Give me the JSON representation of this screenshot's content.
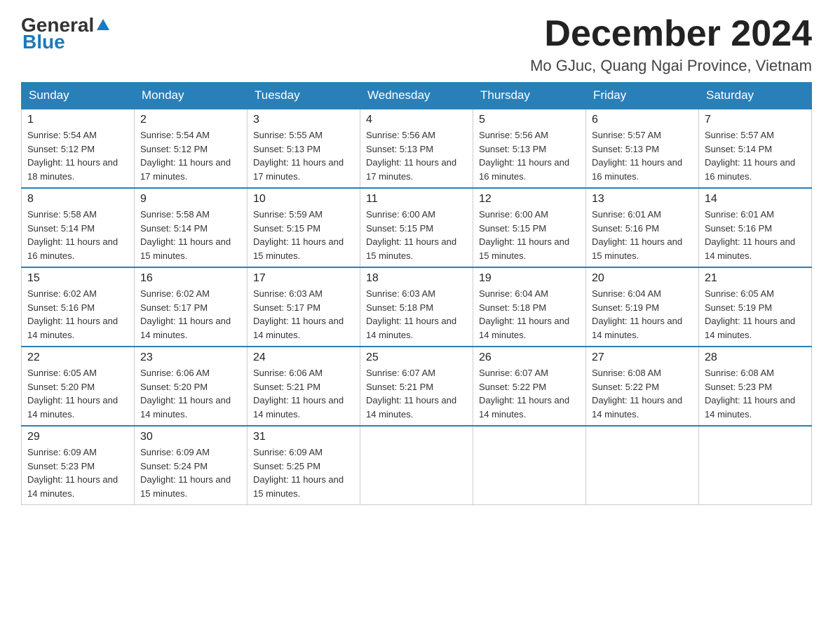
{
  "header": {
    "logo_general": "General",
    "logo_blue": "Blue",
    "month_title": "December 2024",
    "location": "Mo GJuc, Quang Ngai Province, Vietnam"
  },
  "weekdays": [
    "Sunday",
    "Monday",
    "Tuesday",
    "Wednesday",
    "Thursday",
    "Friday",
    "Saturday"
  ],
  "weeks": [
    [
      {
        "day": "1",
        "sunrise": "5:54 AM",
        "sunset": "5:12 PM",
        "daylight": "11 hours and 18 minutes."
      },
      {
        "day": "2",
        "sunrise": "5:54 AM",
        "sunset": "5:12 PM",
        "daylight": "11 hours and 17 minutes."
      },
      {
        "day": "3",
        "sunrise": "5:55 AM",
        "sunset": "5:13 PM",
        "daylight": "11 hours and 17 minutes."
      },
      {
        "day": "4",
        "sunrise": "5:56 AM",
        "sunset": "5:13 PM",
        "daylight": "11 hours and 17 minutes."
      },
      {
        "day": "5",
        "sunrise": "5:56 AM",
        "sunset": "5:13 PM",
        "daylight": "11 hours and 16 minutes."
      },
      {
        "day": "6",
        "sunrise": "5:57 AM",
        "sunset": "5:13 PM",
        "daylight": "11 hours and 16 minutes."
      },
      {
        "day": "7",
        "sunrise": "5:57 AM",
        "sunset": "5:14 PM",
        "daylight": "11 hours and 16 minutes."
      }
    ],
    [
      {
        "day": "8",
        "sunrise": "5:58 AM",
        "sunset": "5:14 PM",
        "daylight": "11 hours and 16 minutes."
      },
      {
        "day": "9",
        "sunrise": "5:58 AM",
        "sunset": "5:14 PM",
        "daylight": "11 hours and 15 minutes."
      },
      {
        "day": "10",
        "sunrise": "5:59 AM",
        "sunset": "5:15 PM",
        "daylight": "11 hours and 15 minutes."
      },
      {
        "day": "11",
        "sunrise": "6:00 AM",
        "sunset": "5:15 PM",
        "daylight": "11 hours and 15 minutes."
      },
      {
        "day": "12",
        "sunrise": "6:00 AM",
        "sunset": "5:15 PM",
        "daylight": "11 hours and 15 minutes."
      },
      {
        "day": "13",
        "sunrise": "6:01 AM",
        "sunset": "5:16 PM",
        "daylight": "11 hours and 15 minutes."
      },
      {
        "day": "14",
        "sunrise": "6:01 AM",
        "sunset": "5:16 PM",
        "daylight": "11 hours and 14 minutes."
      }
    ],
    [
      {
        "day": "15",
        "sunrise": "6:02 AM",
        "sunset": "5:16 PM",
        "daylight": "11 hours and 14 minutes."
      },
      {
        "day": "16",
        "sunrise": "6:02 AM",
        "sunset": "5:17 PM",
        "daylight": "11 hours and 14 minutes."
      },
      {
        "day": "17",
        "sunrise": "6:03 AM",
        "sunset": "5:17 PM",
        "daylight": "11 hours and 14 minutes."
      },
      {
        "day": "18",
        "sunrise": "6:03 AM",
        "sunset": "5:18 PM",
        "daylight": "11 hours and 14 minutes."
      },
      {
        "day": "19",
        "sunrise": "6:04 AM",
        "sunset": "5:18 PM",
        "daylight": "11 hours and 14 minutes."
      },
      {
        "day": "20",
        "sunrise": "6:04 AM",
        "sunset": "5:19 PM",
        "daylight": "11 hours and 14 minutes."
      },
      {
        "day": "21",
        "sunrise": "6:05 AM",
        "sunset": "5:19 PM",
        "daylight": "11 hours and 14 minutes."
      }
    ],
    [
      {
        "day": "22",
        "sunrise": "6:05 AM",
        "sunset": "5:20 PM",
        "daylight": "11 hours and 14 minutes."
      },
      {
        "day": "23",
        "sunrise": "6:06 AM",
        "sunset": "5:20 PM",
        "daylight": "11 hours and 14 minutes."
      },
      {
        "day": "24",
        "sunrise": "6:06 AM",
        "sunset": "5:21 PM",
        "daylight": "11 hours and 14 minutes."
      },
      {
        "day": "25",
        "sunrise": "6:07 AM",
        "sunset": "5:21 PM",
        "daylight": "11 hours and 14 minutes."
      },
      {
        "day": "26",
        "sunrise": "6:07 AM",
        "sunset": "5:22 PM",
        "daylight": "11 hours and 14 minutes."
      },
      {
        "day": "27",
        "sunrise": "6:08 AM",
        "sunset": "5:22 PM",
        "daylight": "11 hours and 14 minutes."
      },
      {
        "day": "28",
        "sunrise": "6:08 AM",
        "sunset": "5:23 PM",
        "daylight": "11 hours and 14 minutes."
      }
    ],
    [
      {
        "day": "29",
        "sunrise": "6:09 AM",
        "sunset": "5:23 PM",
        "daylight": "11 hours and 14 minutes."
      },
      {
        "day": "30",
        "sunrise": "6:09 AM",
        "sunset": "5:24 PM",
        "daylight": "11 hours and 15 minutes."
      },
      {
        "day": "31",
        "sunrise": "6:09 AM",
        "sunset": "5:25 PM",
        "daylight": "11 hours and 15 minutes."
      },
      null,
      null,
      null,
      null
    ]
  ]
}
